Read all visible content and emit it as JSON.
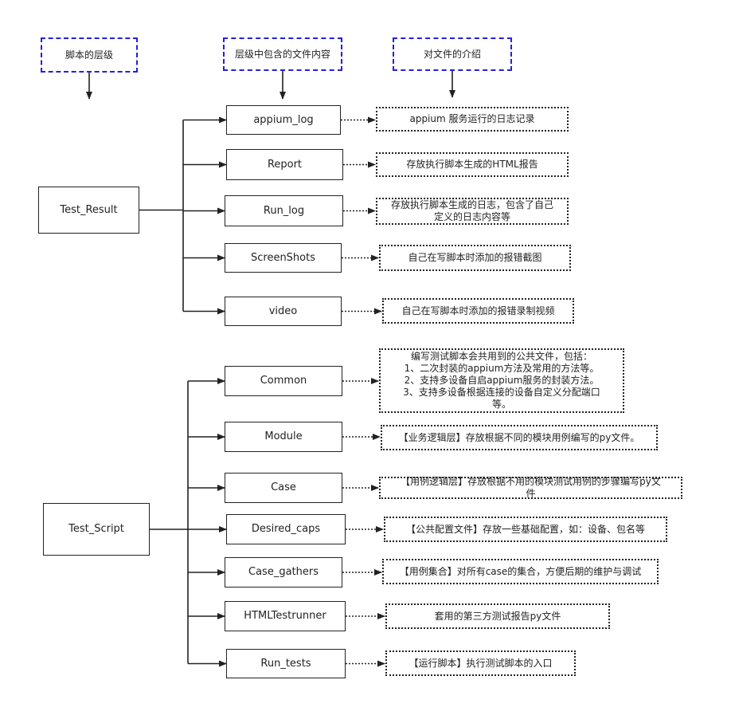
{
  "headers": [
    "脚本的层级",
    "层级中包含的文件内容",
    "对文件的介绍"
  ],
  "groups": [
    {
      "root": "Test_Result",
      "children": [
        {
          "name": "appium_log",
          "desc": "appium 服务运行的日志记录"
        },
        {
          "name": "Report",
          "desc": "存放执行脚本生成的HTML报告"
        },
        {
          "name": "Run_log",
          "desc": "存放执行脚本生成的日志，包含了自己\n定义的日志内容等"
        },
        {
          "name": "ScreenShots",
          "desc": "自己在写脚本时添加的报错截图"
        },
        {
          "name": "video",
          "desc": "自己在写脚本时添加的报错录制视频"
        }
      ]
    },
    {
      "root": "Test_Script",
      "children": [
        {
          "name": "Common",
          "desc": "编写测试脚本会共用到的公共文件，包括：\n1、二次封装的appium方法及常用的方法等。\n2、支持多设备自启appium服务的封装方法。\n3、支持多设备根据连接的设备自定义分配端口\n等。"
        },
        {
          "name": "Module",
          "desc": "【业务逻辑层】存放根据不同的模块用例编写的py文件。"
        },
        {
          "name": "Case",
          "desc": "【用例逻辑层】存放根据不用的模块测试用例的步骤编写py文\n件"
        },
        {
          "name": "Desired_caps",
          "desc": "【公共配置文件】存放一些基础配置，如：设备、包名等"
        },
        {
          "name": "Case_gathers",
          "desc": "【用例集合】对所有case的集合，方便后期的维护与调试"
        },
        {
          "name": "HTMLTestrunner",
          "desc": "套用的第三方测试报告py文件"
        },
        {
          "name": "Run_tests",
          "desc": "【运行脚本】执行测试脚本的入口"
        }
      ]
    }
  ],
  "colors": {
    "header_border": "#2222dd",
    "line": "#222222"
  }
}
